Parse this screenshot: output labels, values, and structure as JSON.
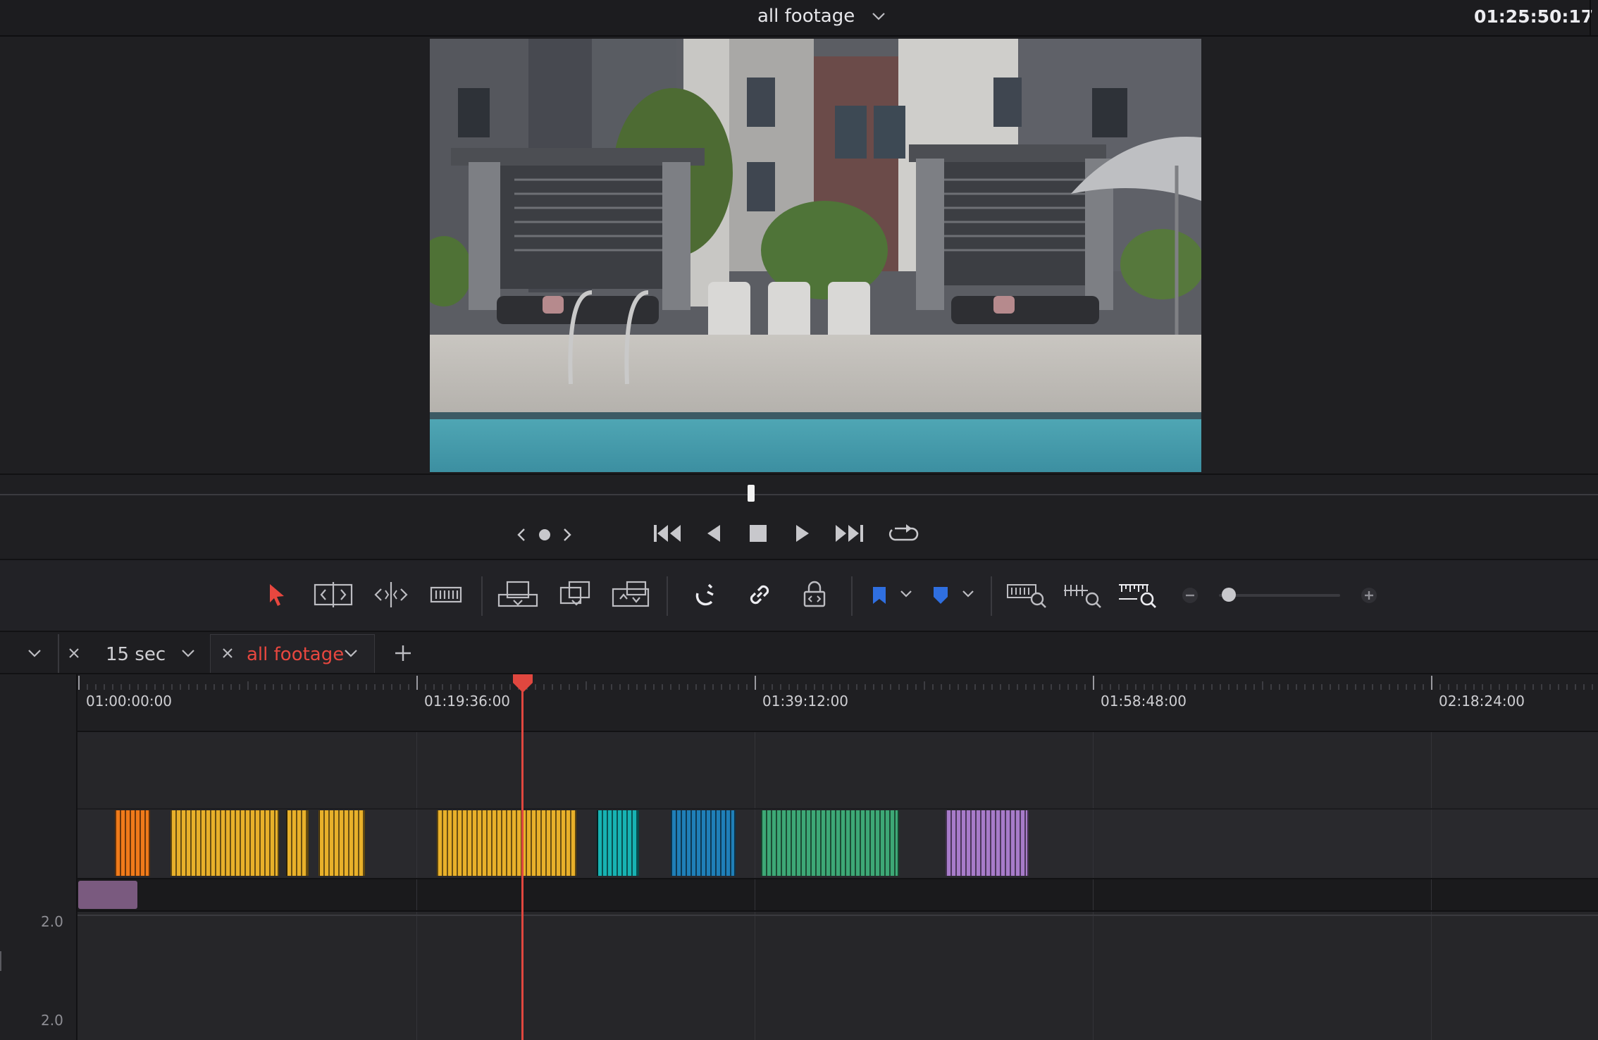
{
  "header": {
    "title": "all footage",
    "timecode": "01:25:50:17"
  },
  "viewer": {
    "playhead_fraction": 0.47
  },
  "transport": {
    "icons": [
      "prev-marker-icon",
      "marker-dot-icon",
      "next-marker-icon",
      "go-to-start-icon",
      "play-reverse-icon",
      "stop-icon",
      "play-icon",
      "go-to-end-icon",
      "loop-icon"
    ]
  },
  "toolbar": {
    "tools": [
      "selection-mode-icon",
      "trim-edit-mode-icon",
      "dynamic-trim-mode-icon",
      "blade-edit-mode-icon",
      "insert-clip-icon",
      "overwrite-clip-icon",
      "replace-clip-icon",
      "snapping-icon",
      "linked-selection-icon",
      "position-lock-icon",
      "flag-icon",
      "marker-icon",
      "full-extent-zoom-icon",
      "detail-zoom-icon",
      "custom-zoom-icon"
    ],
    "flag_color": "#2f6fe0",
    "marker_color": "#2f6fe0",
    "zoom_level": 0.08
  },
  "tabs": [
    {
      "label": "15 sec",
      "active": false
    },
    {
      "label": "all footage",
      "active": true
    }
  ],
  "timeline": {
    "ruler_labels": [
      "01:00:00:00",
      "01:19:36:00",
      "01:39:12:00",
      "01:58:48:00",
      "02:18:24:00"
    ],
    "audio_levels": [
      "2.0",
      "2.0"
    ],
    "playhead_color": "#e0473f",
    "clip_groups": [
      {
        "color": "#f07a1a"
      },
      {
        "color": "#e8b02a"
      },
      {
        "color": "#e8b02a"
      },
      {
        "color": "#e8b02a"
      },
      {
        "color": "#e8b02a"
      },
      {
        "color": "#17b3b3"
      },
      {
        "color": "#1f7fb8"
      },
      {
        "color": "#3da876"
      },
      {
        "color": "#a77bc9"
      },
      {
        "color": "#f08cbf"
      }
    ],
    "audio_clip_color": "#7a5a7f"
  }
}
